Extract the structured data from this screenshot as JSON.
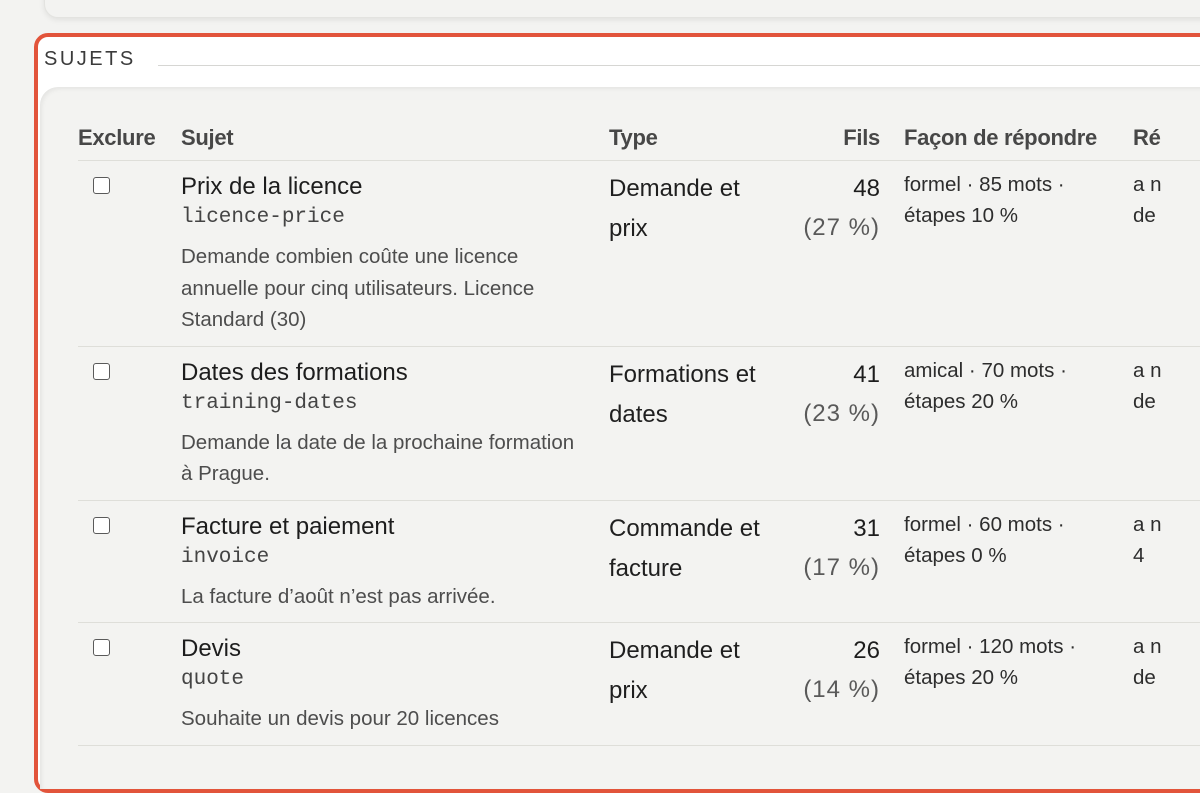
{
  "section": {
    "legend": "SUJETS"
  },
  "table": {
    "headers": {
      "exclude": "Exclure",
      "subject": "Sujet",
      "type": "Type",
      "threads": "Fils",
      "style": "Façon de répondre",
      "reply": "Ré"
    },
    "rows": [
      {
        "title": "Prix de la licence",
        "slug": "licence-price",
        "description": "Demande combien coûte une licence annuelle pour cinq utilisateurs. Licence Standard (30)",
        "type": "Demande et prix",
        "count": "48",
        "percent": "(27 %)",
        "style": "formel · 85 mots · étapes 10 %",
        "reply": [
          "a n",
          "de"
        ]
      },
      {
        "title": "Dates des formations",
        "slug": "training-dates",
        "description": "Demande la date de la prochaine formation à Prague.",
        "type": "Formations et dates",
        "count": "41",
        "percent": "(23 %)",
        "style": "amical · 70 mots · étapes 20 %",
        "reply": [
          "a n",
          "de"
        ]
      },
      {
        "title": "Facture et paiement",
        "slug": "invoice",
        "description": "La facture d’août n’est pas arrivée.",
        "type": "Commande et facture",
        "count": "31",
        "percent": "(17 %)",
        "style": "formel · 60 mots · étapes 0 %",
        "reply": [
          "a n",
          "4"
        ]
      },
      {
        "title": "Devis",
        "slug": "quote",
        "description": "Souhaite un devis pour 20 licences",
        "type": "Demande et prix",
        "count": "26",
        "percent": "(14 %)",
        "style": "formel · 120 mots · étapes 20 %",
        "reply": [
          "a n",
          "de"
        ]
      }
    ]
  }
}
